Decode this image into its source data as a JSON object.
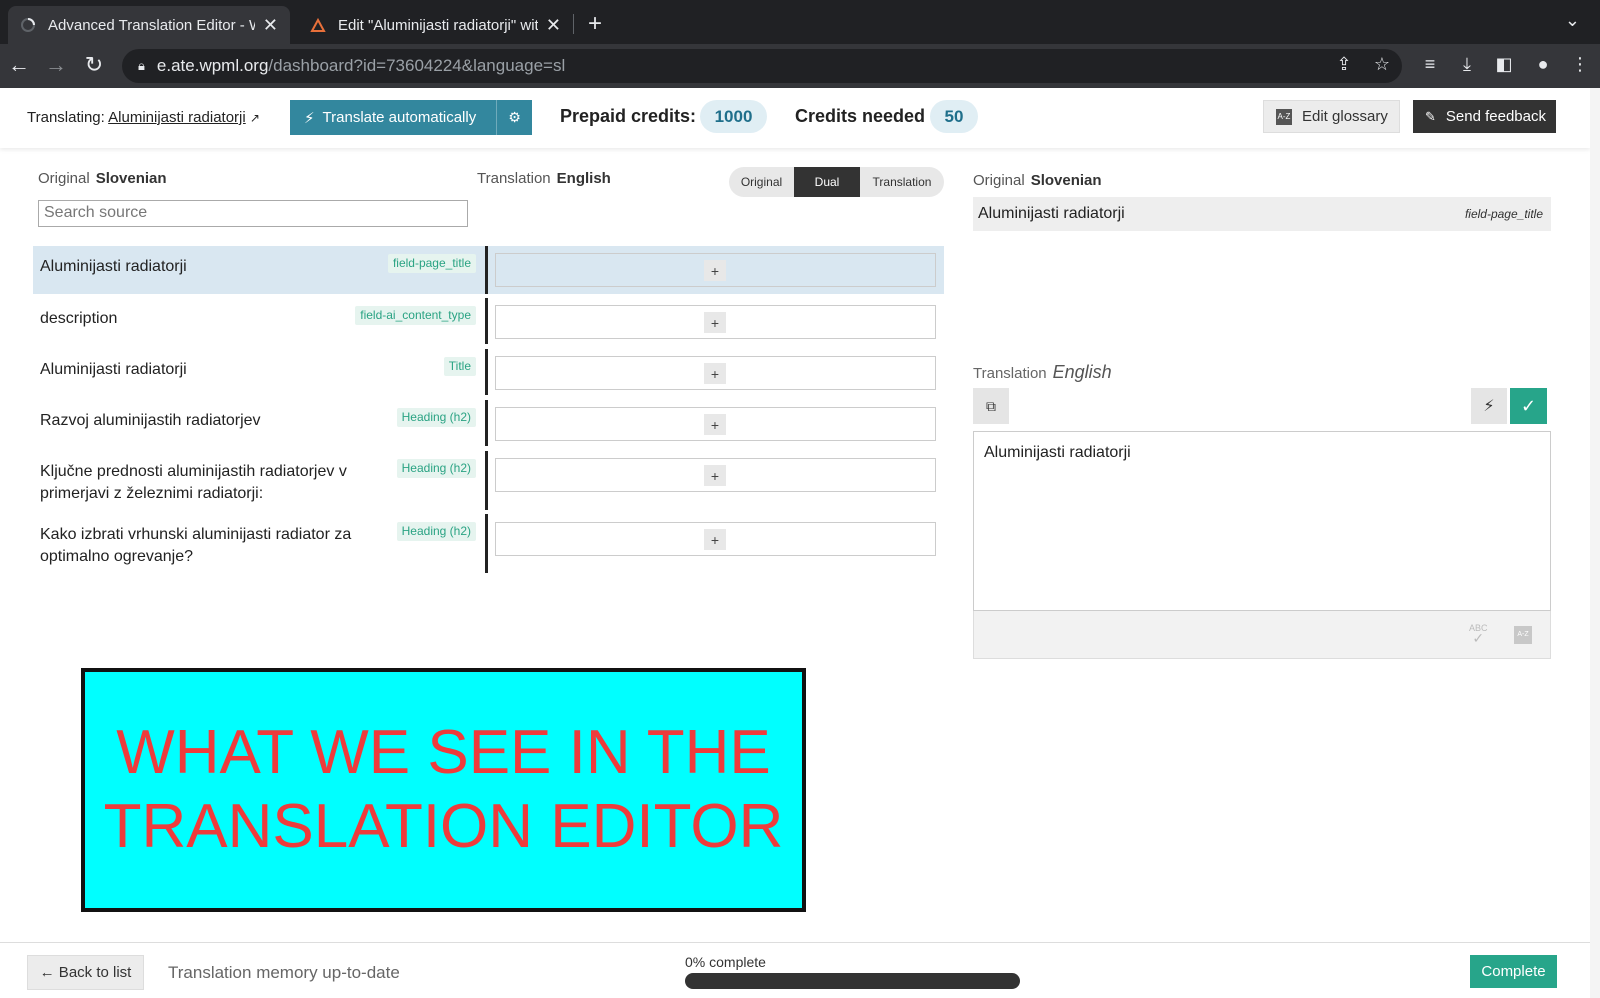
{
  "browser": {
    "tabs": [
      {
        "title": "Advanced Translation Editor - W",
        "active": true
      },
      {
        "title": "Edit \"Aluminijasti radiatorji\" wit",
        "active": false
      }
    ],
    "url_host": "e.ate.wpml.org",
    "url_path": "/dashboard?id=73604224&language=sl"
  },
  "header": {
    "translating_label": "Translating:",
    "translating_link": "Aluminijasti radiatorji",
    "translate_auto": "Translate automatically",
    "prepaid_label": "Prepaid credits:",
    "prepaid_value": "1000",
    "needed_label": "Credits needed",
    "needed_value": "50",
    "edit_glossary": "Edit glossary",
    "send_feedback": "Send feedback"
  },
  "editor": {
    "original_label": "Original",
    "original_lang": "Slovenian",
    "translation_label": "Translation",
    "translation_lang": "English",
    "search_placeholder": "Search source",
    "view_modes": {
      "original": "Original",
      "dual": "Dual",
      "translation": "Translation"
    },
    "rows": [
      {
        "source": "Aluminijasti radiatorji",
        "tag": "field-page_title",
        "selected": true
      },
      {
        "source": "description",
        "tag": "field-ai_content_type",
        "selected": false
      },
      {
        "source": "Aluminijasti radiatorji",
        "tag": "Title",
        "selected": false
      },
      {
        "source": "Razvoj aluminijastih radiatorjev",
        "tag": "Heading (h2)",
        "selected": false
      },
      {
        "source": "Ključne prednosti aluminijastih radiatorjev v primerjavi z železnimi radiatorji:",
        "tag": "Heading (h2)",
        "selected": false
      },
      {
        "source": "Kako izbrati vrhunski aluminijasti radiator za optimalno ogrevanje?",
        "tag": "Heading (h2)",
        "selected": false
      }
    ]
  },
  "panel": {
    "original_label": "Original",
    "original_lang": "Slovenian",
    "original_text": "Aluminijasti radiatorji",
    "original_tag": "field-page_title",
    "translation_label": "Translation",
    "translation_lang": "English",
    "translation_text": "Aluminijasti radiatorji",
    "spell_label": "ABC"
  },
  "banner": {
    "text": "WHAT WE SEE IN THE TRANSLATION EDITOR",
    "bg_color": "#00ffff",
    "text_color": "#ee3b3b"
  },
  "footer": {
    "back": "← Back to list",
    "tm_status": "Translation memory up-to-date",
    "progress_label": "0% complete",
    "progress_percent": 0,
    "complete": "Complete"
  },
  "colors": {
    "accent_teal": "#33879e",
    "success_green": "#27a58a",
    "tag_green": "#2aa383",
    "selected_row": "#d9e7f1"
  }
}
